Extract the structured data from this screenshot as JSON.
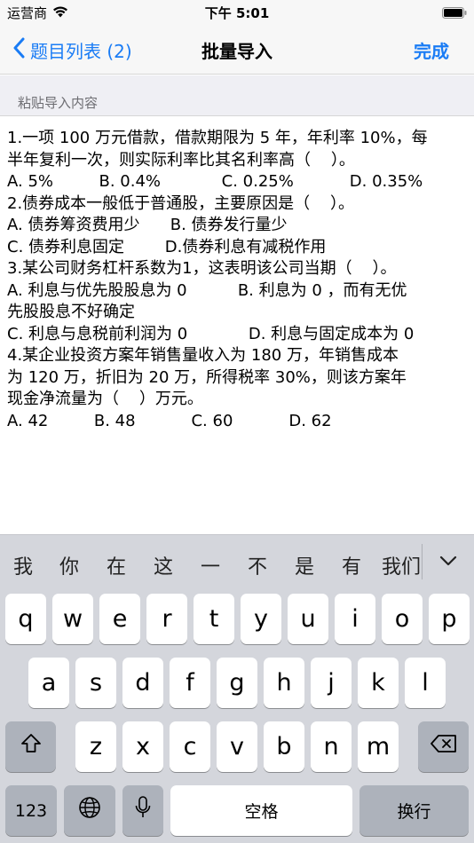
{
  "status_bar": {
    "carrier": "运营商",
    "time": "下午 5:01"
  },
  "nav": {
    "back_label": "题目列表 (2)",
    "title": "批量导入",
    "done_label": "完成"
  },
  "section": {
    "header": "粘贴导入内容"
  },
  "content": {
    "lines": [
      "1.一项 100 万元借款，借款期限为 5 年，年利率 10%，每",
      "半年复利一次，则实际利率比其名利率高（    ）。",
      "A. 5%         B. 0.4%            C. 0.25%           D. 0.35%",
      "2.债券成本一般低于普通股，主要原因是（    ）。",
      "A. 债券筹资费用少      B. 债券发行量少",
      "C. 债券利息固定        D.债券利息有减税作用",
      "3.某公司财务杠杆系数为1，这表明该公司当期（    ）。",
      "A. 利息与优先股股息为 0          B. 利息为 0 ，而有无优",
      "先股股息不好确定",
      "C. 利息与息税前利润为 0            D. 利息与固定成本为 0",
      "4.某企业投资方案年销售量收入为 180 万，年销售成本",
      "为 120 万，折旧为 20 万，所得税率 30%，则该方案年",
      "现金净流量为（    ）万元。",
      "A. 42         B. 48           C. 60           D. 62"
    ]
  },
  "candidates": [
    "我",
    "你",
    "在",
    "这",
    "一",
    "不",
    "是",
    "有",
    "我们"
  ],
  "keyboard": {
    "row1": [
      "q",
      "w",
      "e",
      "r",
      "t",
      "y",
      "u",
      "i",
      "o",
      "p"
    ],
    "row2": [
      "a",
      "s",
      "d",
      "f",
      "g",
      "h",
      "j",
      "k",
      "l"
    ],
    "row3": [
      "z",
      "x",
      "c",
      "v",
      "b",
      "n",
      "m"
    ],
    "numbers_label": "123",
    "space_label": "空格",
    "return_label": "换行"
  },
  "colors": {
    "accent": "#1a7cf5",
    "keyboard_bg": "#d4d6dc",
    "section_bg": "#efeff4"
  }
}
